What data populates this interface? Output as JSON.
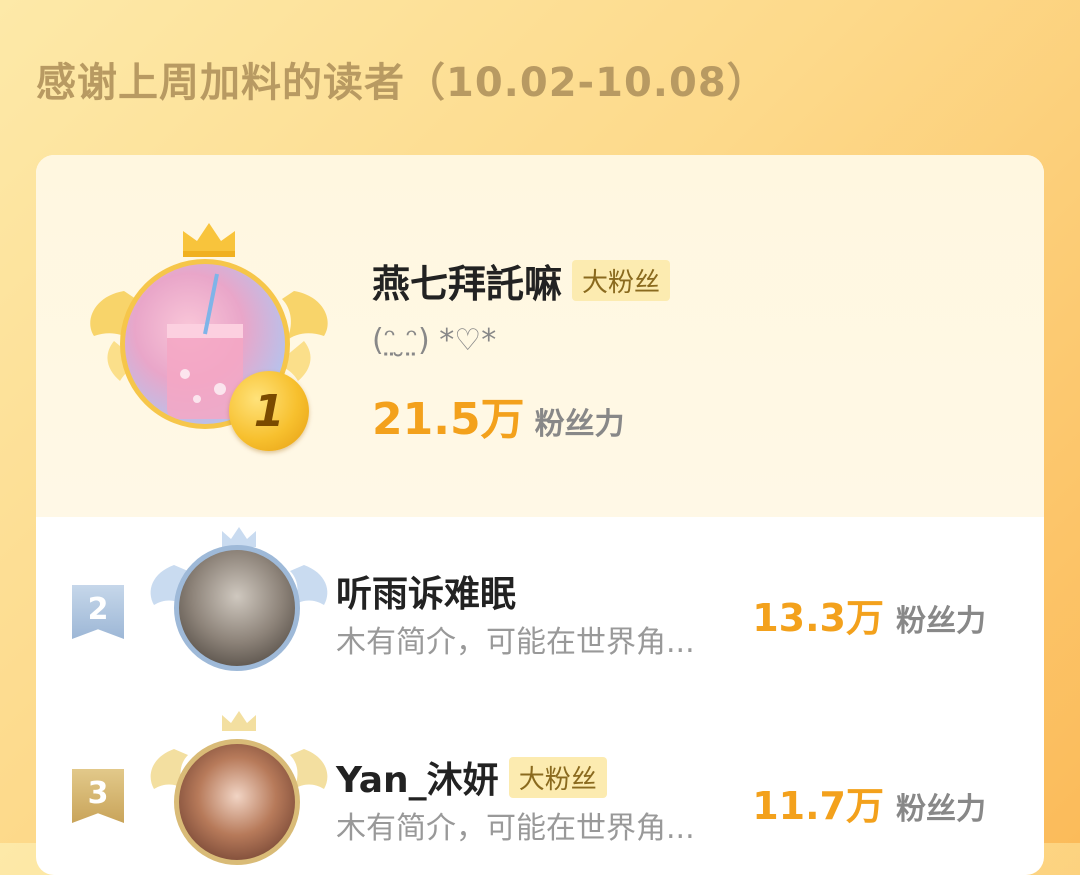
{
  "page": {
    "title": "感谢上周加料的读者（10.02-10.08）"
  },
  "ranking": [
    {
      "rank": "1",
      "name": "燕七拜託嘛",
      "badge": "大粉丝",
      "bio": "(ᵔ̤ ̮ᵔ̤) *♡*",
      "power_value": "21.5万",
      "power_label": "粉丝力"
    },
    {
      "rank": "2",
      "name": "听雨诉难眠",
      "badge": "",
      "bio": "木有简介，可能在世界角...",
      "power_value": "13.3万",
      "power_label": "粉丝力"
    },
    {
      "rank": "3",
      "name": "Yan_沐妍",
      "badge": "大粉丝",
      "bio": "木有简介，可能在世界角...",
      "power_value": "11.7万",
      "power_label": "粉丝力"
    }
  ],
  "colors": {
    "accent": "#f3a11c",
    "gold": "#f6c64a",
    "silver": "#9eb9d8",
    "bronze": "#d9bb77"
  },
  "icons": {
    "crown": "crown-icon",
    "wings": "wings-icon"
  }
}
